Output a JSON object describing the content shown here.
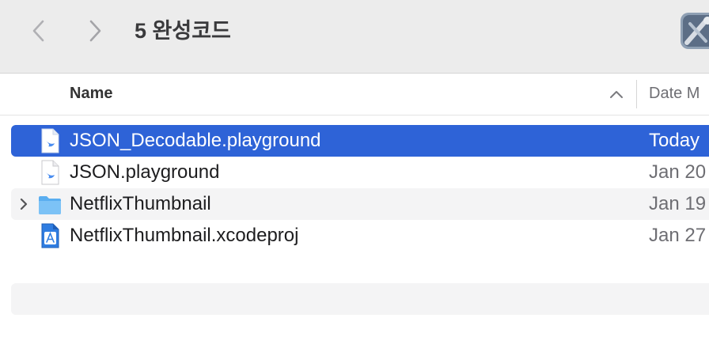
{
  "window": {
    "title": "5 완성코드",
    "back_icon": "chevron-left-icon",
    "forward_icon": "chevron-right-icon",
    "app_icon": "xcode-app-icon"
  },
  "columns": {
    "name": "Name",
    "date": "Date M",
    "sort_icon": "chevron-up-icon"
  },
  "files": [
    {
      "name": "JSON_Decodable.playground",
      "date": "Today",
      "icon": "swift-playground-icon",
      "selected": true,
      "expandable": false
    },
    {
      "name": "JSON.playground",
      "date": "Jan 20",
      "icon": "swift-playground-icon",
      "selected": false,
      "expandable": false
    },
    {
      "name": "NetflixThumbnail",
      "date": "Jan 19",
      "icon": "folder-icon",
      "selected": false,
      "expandable": true
    },
    {
      "name": "NetflixThumbnail.xcodeproj",
      "date": "Jan 27",
      "icon": "xcodeproj-icon",
      "selected": false,
      "expandable": false
    }
  ],
  "colors": {
    "selection": "#2e63d7",
    "alternate_row": "#f4f4f5",
    "toolbar": "#ececec"
  }
}
